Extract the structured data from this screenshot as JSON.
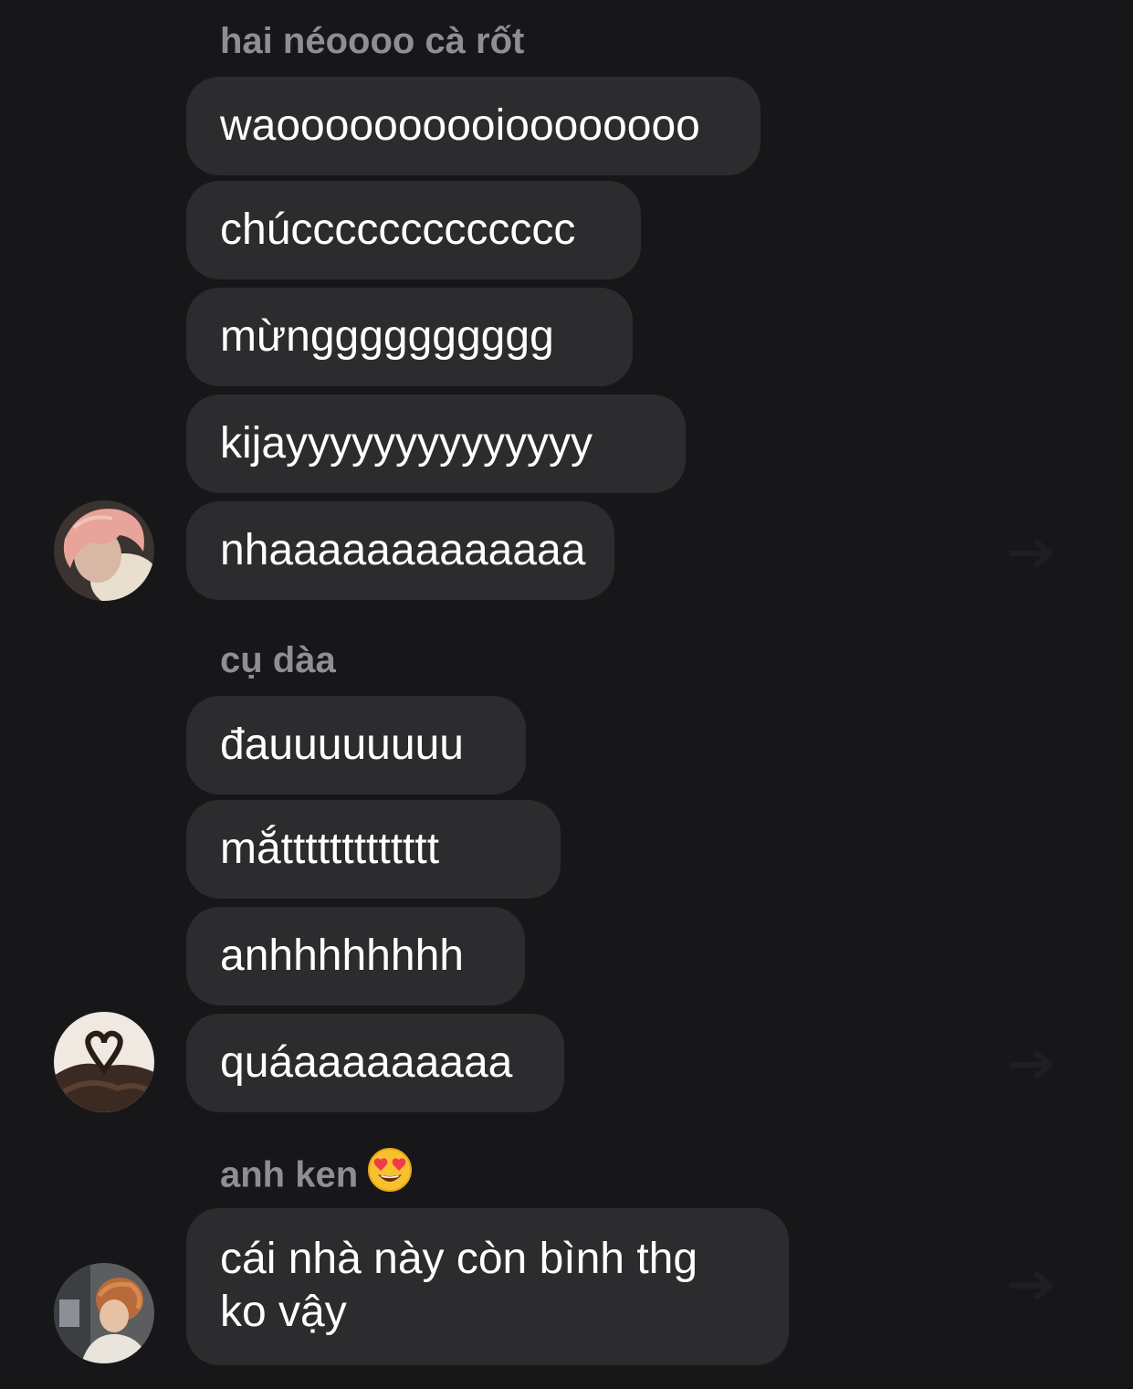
{
  "groups": [
    {
      "sender": "hai néoooo cà rốt",
      "messages": [
        "waoooooooooioooooooo",
        "chúccccccccccccc",
        "mừngggggggggg",
        "kijayyyyyyyyyyyyyy",
        "nhaaaaaaaaaaaaa"
      ]
    },
    {
      "sender": "cụ dàa",
      "messages": [
        "đauuuuuuuu",
        "mắttttttttttttt",
        "anhhhhhhhh",
        "quáaaaaaaaaa"
      ]
    },
    {
      "sender": "anh ken",
      "sender_emoji": "smiling-face-with-heart-eyes",
      "messages": [
        "cái nhà này còn bình thg ko vậy"
      ]
    }
  ],
  "colors": {
    "background": "#17171a",
    "bubble": "#2c2c2e",
    "message_text": "#ffffff",
    "sender_text": "#8e8e93"
  }
}
